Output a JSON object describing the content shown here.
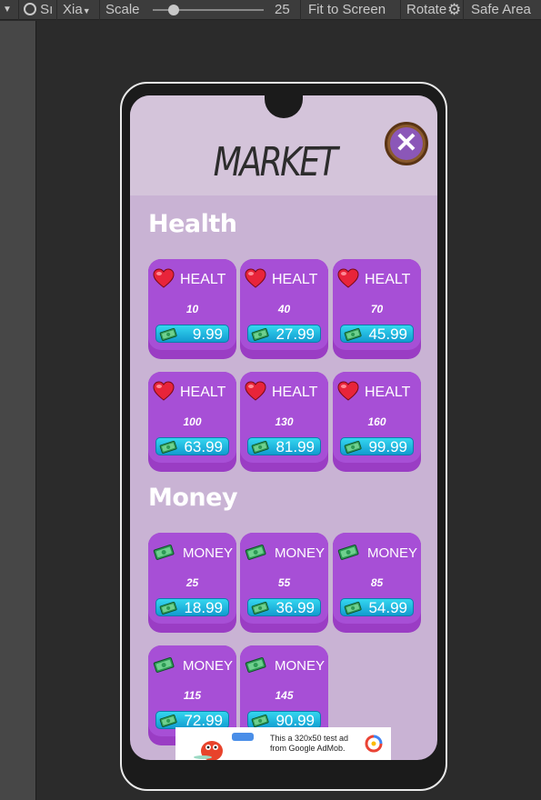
{
  "toolbar": {
    "display": "Sı",
    "device": "Xia",
    "scale_label": "Scale",
    "scale_value": "25",
    "fit_label": "Fit to Screen",
    "rotate_label": "Rotate",
    "safe_area_label": "Safe Area"
  },
  "market": {
    "title": "MARKET",
    "close_symbol": "✕"
  },
  "health": {
    "title": "Health",
    "items": [
      {
        "label": "HEALT",
        "amount": "10",
        "price": "9.99"
      },
      {
        "label": "HEALT",
        "amount": "40",
        "price": "27.99"
      },
      {
        "label": "HEALT",
        "amount": "70",
        "price": "45.99"
      },
      {
        "label": "HEALT",
        "amount": "100",
        "price": "63.99"
      },
      {
        "label": "HEALT",
        "amount": "130",
        "price": "81.99"
      },
      {
        "label": "HEALT",
        "amount": "160",
        "price": "99.99"
      }
    ]
  },
  "money": {
    "title": "Money",
    "items": [
      {
        "label": "MONEY",
        "amount": "25",
        "price": "18.99"
      },
      {
        "label": "MONEY",
        "amount": "55",
        "price": "36.99"
      },
      {
        "label": "MONEY",
        "amount": "85",
        "price": "54.99"
      },
      {
        "label": "MONEY",
        "amount": "115",
        "price": "72.99"
      },
      {
        "label": "MONEY",
        "amount": "145",
        "price": "90.99"
      }
    ]
  },
  "ad": {
    "text": "This a 320x50 test ad from Google AdMob."
  },
  "icons": {
    "health": "heart-icon",
    "money": "cash-icon",
    "close": "close-icon"
  },
  "colors": {
    "screen_bg": "#c9b3d4",
    "card": "#a74fd6",
    "price_bar": "#22bde3"
  }
}
